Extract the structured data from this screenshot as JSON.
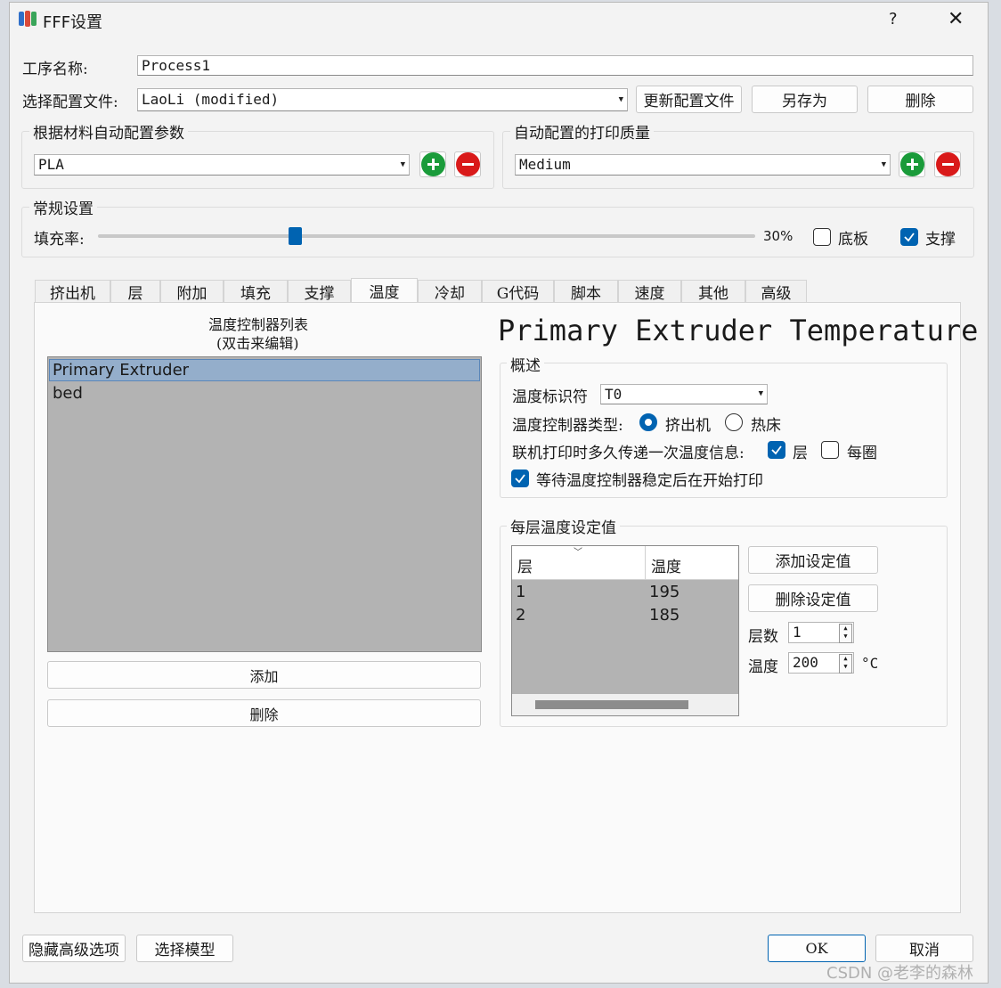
{
  "window": {
    "title": "FFF设置",
    "help": "?",
    "close": "✕"
  },
  "process": {
    "label": "工序名称:",
    "value": "Process1"
  },
  "profile": {
    "label": "选择配置文件:",
    "value": "LaoLi (modified)",
    "update_btn": "更新配置文件",
    "saveas_btn": "另存为",
    "delete_btn": "删除"
  },
  "material_group": {
    "title": "根据材料自动配置参数",
    "value": "PLA"
  },
  "quality_group": {
    "title": "自动配置的打印质量",
    "value": "Medium"
  },
  "general": {
    "title": "常规设置",
    "infill_label": "填充率:",
    "infill_value": "30%",
    "infill_fraction": 0.3,
    "raft_label": "底板",
    "raft_checked": false,
    "support_label": "支撑",
    "support_checked": true
  },
  "tabs": [
    "挤出机",
    "层",
    "附加",
    "填充",
    "支撑",
    "温度",
    "冷却",
    "G代码",
    "脚本",
    "速度",
    "其他",
    "高级"
  ],
  "active_tab": "温度",
  "temp_list": {
    "title1": "温度控制器列表",
    "title2": "(双击来编辑)",
    "items": [
      "Primary Extruder",
      "bed"
    ],
    "add_btn": "添加",
    "delete_btn": "删除"
  },
  "detail": {
    "heading": "Primary Extruder Temperature",
    "overview_title": "概述",
    "identifier_label": "温度标识符",
    "identifier_value": "T0",
    "type_label": "温度控制器类型:",
    "type_extruder": "挤出机",
    "type_bed": "热床",
    "report_label": "联机打印时多久传递一次温度信息:",
    "report_layer": "层",
    "report_loop": "每圈",
    "wait_label": "等待温度控制器稳定后在开始打印"
  },
  "setpoints": {
    "title": "每层温度设定值",
    "col_layer": "层",
    "col_temp": "温度",
    "rows": [
      {
        "layer": "1",
        "temp": "195"
      },
      {
        "layer": "2",
        "temp": "185"
      }
    ],
    "add_btn": "添加设定值",
    "delete_btn": "删除设定值",
    "layer_label": "层数",
    "layer_value": "1",
    "temp_label": "温度",
    "temp_value": "200",
    "temp_unit": "°C"
  },
  "footer": {
    "hide_adv": "隐藏高级选项",
    "select_model": "选择模型",
    "ok": "OK",
    "cancel": "取消"
  },
  "watermark": "CSDN @老李的森林",
  "colors": {
    "accent": "#0063b1",
    "add": "#1a9b3a",
    "remove": "#d91a1a",
    "list_bg": "#b3b3b3",
    "list_sel": "#94aecb"
  }
}
